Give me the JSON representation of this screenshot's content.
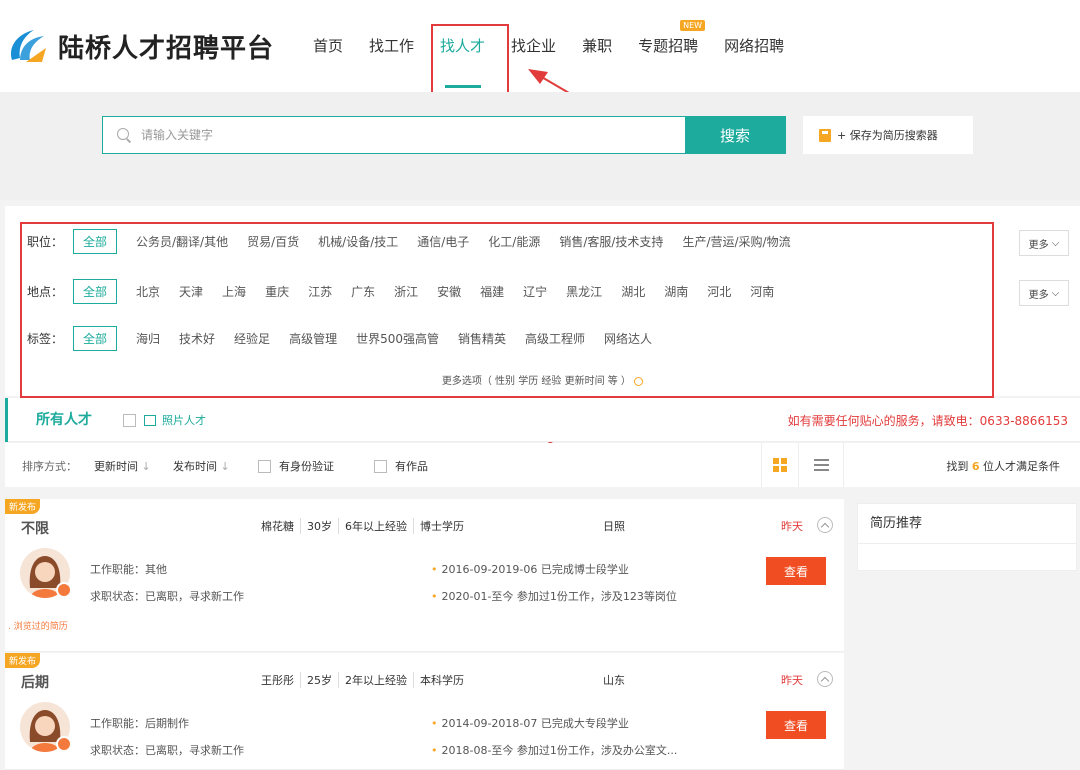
{
  "header": {
    "logo_text": "陆桥人才招聘平台",
    "nav": [
      {
        "label": "首页"
      },
      {
        "label": "找工作"
      },
      {
        "label": "找人才"
      },
      {
        "label": "找企业"
      },
      {
        "label": "兼职"
      },
      {
        "label": "专题招聘",
        "badge": "NEW"
      },
      {
        "label": "网络招聘"
      }
    ]
  },
  "search": {
    "placeholder": "请输入关键字",
    "button": "搜索",
    "save_label": "+ 保存为简历搜索器"
  },
  "filters": {
    "position": {
      "label": "职位：",
      "options": [
        "全部",
        "公务员/翻译/其他",
        "贸易/百货",
        "机械/设备/技工",
        "通信/电子",
        "化工/能源",
        "销售/客服/技术支持",
        "生产/营运/采购/物流"
      ],
      "more": "更多"
    },
    "location": {
      "label": "地点：",
      "options": [
        "全部",
        "北京",
        "天津",
        "上海",
        "重庆",
        "江苏",
        "广东",
        "浙江",
        "安徽",
        "福建",
        "辽宁",
        "黑龙江",
        "湖北",
        "湖南",
        "河北",
        "河南"
      ],
      "more": "更多"
    },
    "tags": {
      "label": "标签：",
      "options": [
        "全部",
        "海归",
        "技术好",
        "经验足",
        "高级管理",
        "世界500强高管",
        "销售精英",
        "高级工程师",
        "网络达人"
      ]
    },
    "more_options": "更多选项（ 性别 学历 经验 更新时间 等 ）"
  },
  "tabs": {
    "all": "所有人才",
    "photo": "照片人才",
    "hotline": "如有需要任何贴心的服务，请致电：0633-8866153"
  },
  "sort": {
    "label": "排序方式：",
    "update_time": "更新时间",
    "publish_time": "发布时间",
    "id_verified": "有身份验证",
    "has_works": "有作品",
    "found_prefix": "找到",
    "found_count": "6",
    "found_suffix": "位人才满足条件"
  },
  "list": [
    {
      "tag": "新发布",
      "title": "不限",
      "name": "棉花糖",
      "age": "30岁",
      "exp": "6年以上经验",
      "edu": "博士学历",
      "region": "日照",
      "date": "昨天",
      "job": "工作职能：其他",
      "status": "求职状态：已离职，寻求新工作",
      "exp1": "2016-09-2019-06 已完成博士段学业",
      "exp2": "2020-01-至今 参加过1份工作，涉及123等岗位",
      "button": "查看",
      "viewed": ". 浏览过的简历"
    },
    {
      "tag": "新发布",
      "title": "后期",
      "name": "王彤彤",
      "age": "25岁",
      "exp": "2年以上经验",
      "edu": "本科学历",
      "region": "山东",
      "date": "昨天",
      "job": "工作职能：后期制作",
      "status": "求职状态：已离职，寻求新工作",
      "exp1": "2014-09-2018-07 已完成大专段学业",
      "exp2": "2018-08-至今 参加过1份工作，涉及办公室文...",
      "button": "查看"
    }
  ],
  "side": {
    "title": "简历推荐"
  },
  "colors": {
    "accent": "#1cab9c",
    "orange": "#f5a623",
    "red": "#e23b3b",
    "button_red": "#f04d22"
  }
}
